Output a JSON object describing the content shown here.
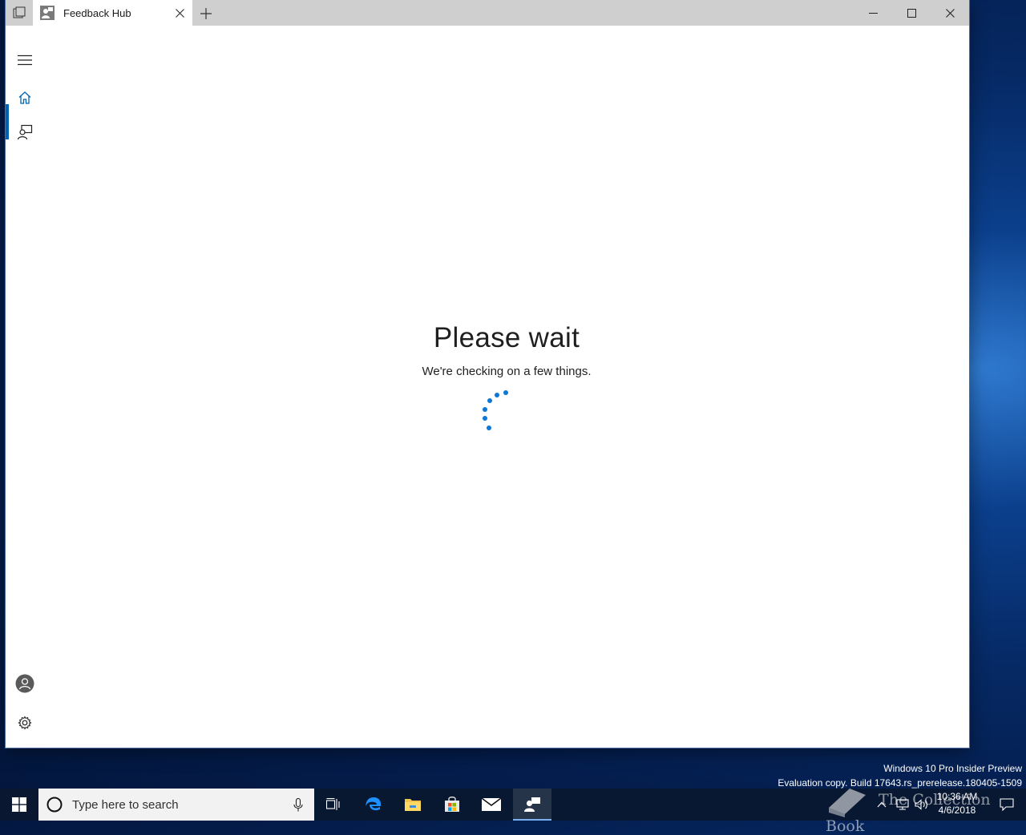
{
  "window": {
    "tab_title": "Feedback Hub",
    "caption": {
      "minimize": "minimize",
      "maximize": "maximize",
      "close": "close"
    }
  },
  "nav": {
    "items": [
      {
        "name": "menu",
        "icon": "hamburger-icon"
      },
      {
        "name": "home",
        "icon": "home-icon",
        "selected": true
      },
      {
        "name": "feedback",
        "icon": "feedback-icon"
      }
    ],
    "bottom": [
      {
        "name": "account",
        "icon": "account-icon"
      },
      {
        "name": "settings",
        "icon": "gear-icon"
      }
    ],
    "accent": "#0063b1"
  },
  "main": {
    "title": "Please wait",
    "subtitle": "We're checking on a few things.",
    "spinner_color": "#0a78d4"
  },
  "desktop": {
    "watermark_line1": "Windows 10 Pro Insider Preview",
    "watermark_line2": "Evaluation copy. Build 17643.rs_prerelease.180405-1509",
    "brand_overlay": "The Collection Book"
  },
  "taskbar": {
    "search_placeholder": "Type here to search",
    "apps": [
      "task-view-icon",
      "edge-icon",
      "file-explorer-icon",
      "store-icon",
      "mail-icon",
      "feedback-hub-icon"
    ],
    "active_app": "feedback-hub-icon",
    "time": "10:36 AM",
    "date": "4/6/2018"
  }
}
